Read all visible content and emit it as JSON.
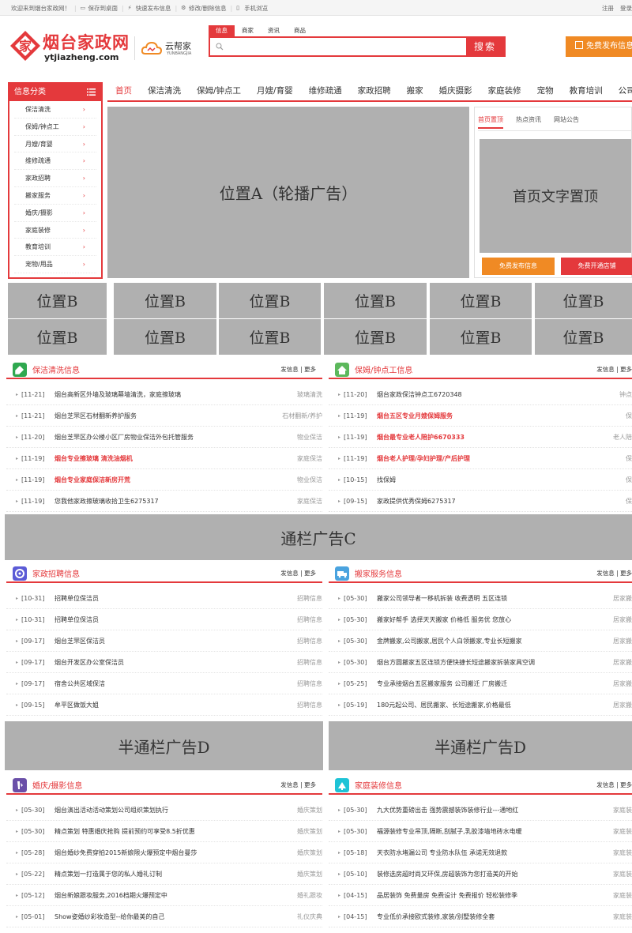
{
  "topbar": {
    "links": [
      "欢迎来到烟台家政网！",
      "保存到桌面",
      "快速发布信息",
      "修改/删除信息",
      "手机浏览"
    ],
    "right": [
      "注册",
      "登录"
    ]
  },
  "logo": {
    "name": "烟台家政网",
    "domain": "ytjiazheng.com",
    "mark": "家"
  },
  "partner": {
    "name": "云帮家",
    "sub": "YUNBANGJIA"
  },
  "search": {
    "tabs": [
      "信息",
      "商家",
      "资讯",
      "商品"
    ],
    "active_tab": "信息",
    "placeholder": "",
    "button": "搜索"
  },
  "publish_button": "免费发布信息",
  "category": {
    "title": "信息分类",
    "items": [
      "保洁清洗",
      "保姆/钟点工",
      "月嫂/育婴",
      "维修疏通",
      "家政招聘",
      "搬家服务",
      "婚庆/摄影",
      "家庭装修",
      "教育培训",
      "宠物/用品"
    ],
    "arrow": "›"
  },
  "nav": {
    "items": [
      "首页",
      "保洁清洗",
      "保姆/钟点工",
      "月嫂/育婴",
      "维修疏通",
      "家政招聘",
      "搬家",
      "婚庆摄影",
      "家庭装修",
      "宠物",
      "教育培训",
      "公司"
    ],
    "active": "首页"
  },
  "ads": {
    "a": "位置A（轮播广告）",
    "b": "位置B",
    "c": "通栏广告C",
    "d": "半通栏广告D"
  },
  "notice": {
    "tabs": [
      "首页置顶",
      "热点资讯",
      "网站公告"
    ],
    "active_tab": "首页置顶",
    "top_text": "首页文字置顶",
    "btn_publish": "免费发布信息",
    "btn_shop": "免费开通店铺"
  },
  "sections": [
    {
      "title": "保洁清洗信息",
      "more": "发信息 | 更多",
      "icon": "broom-icon",
      "color": "#2fa84f",
      "rows": [
        {
          "date": "[11-21]",
          "title": "烟台高新区外墙及玻璃幕墙清洗，家庭擦玻璃",
          "cat": "玻璃清洗",
          "hot": false
        },
        {
          "date": "[11-21]",
          "title": "烟台芝罘区石材翻新养护服务",
          "cat": "石材翻新/养护",
          "hot": false
        },
        {
          "date": "[11-20]",
          "title": "烟台芝罘区办公楼小区厂房物业保洁外包托管服务",
          "cat": "物业保洁",
          "hot": false
        },
        {
          "date": "[11-19]",
          "title": "烟台专业擦玻璃 清洗油烟机",
          "cat": "家庭保洁",
          "hot": true
        },
        {
          "date": "[11-19]",
          "title": "烟台专业家庭保洁新房开荒",
          "cat": "物业保洁",
          "hot": true
        },
        {
          "date": "[11-19]",
          "title": "您我他家政擦玻璃收拾卫生6275317",
          "cat": "家庭保洁",
          "hot": false
        }
      ]
    },
    {
      "title": "保姆/钟点工信息",
      "more": "发信息 | 更多",
      "icon": "house-icon",
      "color": "#5cb85c",
      "rows": [
        {
          "date": "[11-20]",
          "title": "烟台家政保洁钟点工6720348",
          "cat": "钟点工",
          "hot": false
        },
        {
          "date": "[11-19]",
          "title": "烟台五区专业月嫂保姆服务",
          "cat": "保姆",
          "hot": true
        },
        {
          "date": "[11-19]",
          "title": "烟台最专业老人陪护6670333",
          "cat": "老人陪护",
          "hot": true
        },
        {
          "date": "[11-19]",
          "title": "烟台老人护理/孕妇护理/产后护理",
          "cat": "保姆",
          "hot": true
        },
        {
          "date": "[10-15]",
          "title": "找保姆",
          "cat": "保姆",
          "hot": false
        },
        {
          "date": "[09-15]",
          "title": "家政提供优秀保姆6275317",
          "cat": "保姆",
          "hot": false
        }
      ]
    },
    {
      "title": "家政招聘信息",
      "more": "发信息 | 更多",
      "icon": "recruit-icon",
      "color": "#5b5bd6",
      "rows": [
        {
          "date": "[10-31]",
          "title": "招聘单位保洁员",
          "cat": "招聘信息",
          "hot": false
        },
        {
          "date": "[10-31]",
          "title": "招聘单位保洁员",
          "cat": "招聘信息",
          "hot": false
        },
        {
          "date": "[09-17]",
          "title": "烟台芝罘区保洁员",
          "cat": "招聘信息",
          "hot": false
        },
        {
          "date": "[09-17]",
          "title": "烟台开发区办公室保洁员",
          "cat": "招聘信息",
          "hot": false
        },
        {
          "date": "[09-17]",
          "title": "宿舍公共区域保洁",
          "cat": "招聘信息",
          "hot": false
        },
        {
          "date": "[09-15]",
          "title": "牟平区做饭大姐",
          "cat": "招聘信息",
          "hot": false
        }
      ]
    },
    {
      "title": "搬家服务信息",
      "more": "发信息 | 更多",
      "icon": "truck-icon",
      "color": "#4aa3df",
      "rows": [
        {
          "date": "[05-30]",
          "title": "搬家公司领导者一移机拆装 收费透明 五区连锁",
          "cat": "居家搬迁",
          "hot": false
        },
        {
          "date": "[05-30]",
          "title": "搬家好帮手 选择天天搬家 价格低 服务优 您放心",
          "cat": "居家搬迁",
          "hot": false
        },
        {
          "date": "[05-30]",
          "title": "金牌搬家,公司搬家,居民个人白领搬家,专业长短搬家",
          "cat": "居家搬迁",
          "hot": false
        },
        {
          "date": "[05-30]",
          "title": "烟台方圆搬家五区连锁方便快捷长短途搬家拆装家具空调",
          "cat": "居家搬迁",
          "hot": false
        },
        {
          "date": "[05-25]",
          "title": "专业承接烟台五区搬家服务 公司搬迁 厂房搬迁",
          "cat": "居家搬迁",
          "hot": false
        },
        {
          "date": "[05-19]",
          "title": "180元起公司、居民搬家、长短途搬家,价格最低",
          "cat": "居家搬迁",
          "hot": false
        }
      ]
    },
    {
      "title": "婚庆/摄影信息",
      "more": "发信息 | 更多",
      "icon": "camera-icon",
      "color": "#6a4fa8",
      "rows": [
        {
          "date": "[05-30]",
          "title": "烟台演出活动活动策划公司组织策划执行",
          "cat": "婚庆策划",
          "hot": false
        },
        {
          "date": "[05-30]",
          "title": "精点策划 特惠婚庆抢购 提前预约可享受8.5折优惠",
          "cat": "婚庆策划",
          "hot": false
        },
        {
          "date": "[05-28]",
          "title": "烟台婚纱免费穿拍2015新娘限火爆预定中烟台曼莎",
          "cat": "婚庆策划",
          "hot": false
        },
        {
          "date": "[05-22]",
          "title": "精点策划一打造属于您的私人婚礼订制",
          "cat": "婚庆策划",
          "hot": false
        },
        {
          "date": "[05-12]",
          "title": "烟台新娘跟妆服务,2016档期火爆预定中",
          "cat": "婚礼跟妆",
          "hot": false
        },
        {
          "date": "[05-01]",
          "title": "Show姿婚纱彩妆造型--给你最美的自己",
          "cat": "礼仪庆典",
          "hot": false
        }
      ]
    },
    {
      "title": "家庭装修信息",
      "more": "发信息 | 更多",
      "icon": "paint-icon",
      "color": "#1ec3d6",
      "rows": [
        {
          "date": "[05-30]",
          "title": "九大优势重磅出击 强势震撼装饰装修行业---通地红",
          "cat": "家庭装修",
          "hot": false
        },
        {
          "date": "[05-30]",
          "title": "福源装修专业吊顶,隔断,刮腻子,乳胶漆墙地砖水电暖",
          "cat": "家庭装修",
          "hot": false
        },
        {
          "date": "[05-18]",
          "title": "天衣防水堵漏公司 专业防水队伍 承诺无效退款",
          "cat": "家庭装修",
          "hot": false
        },
        {
          "date": "[05-10]",
          "title": "装修选房超时尚又环保,房超装饰为您打造美的开始",
          "cat": "家庭装修",
          "hot": false
        },
        {
          "date": "[04-15]",
          "title": "品居装饰 免费量房 免费设计 免费报价 轻松装修季",
          "cat": "家庭装修",
          "hot": false
        },
        {
          "date": "[04-15]",
          "title": "专业低价承接欧式装修,家装/别墅装修全套",
          "cat": "家庭装修",
          "hot": false
        }
      ]
    }
  ]
}
